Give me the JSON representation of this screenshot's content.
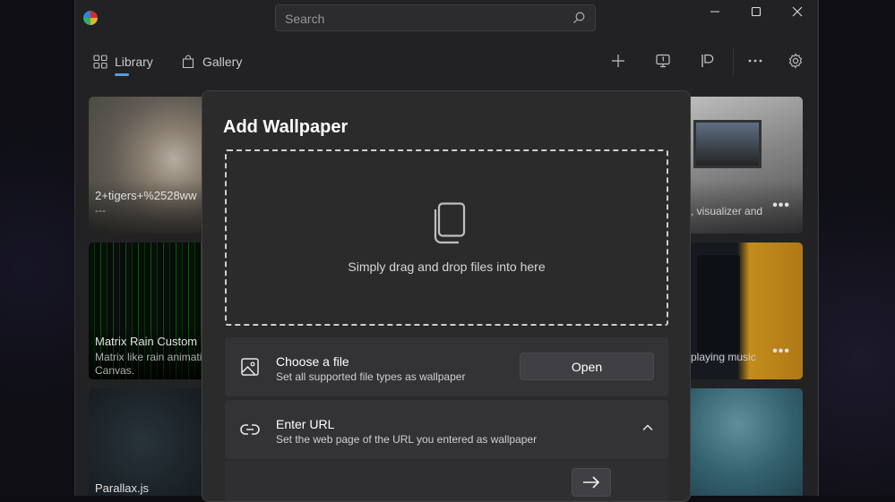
{
  "search": {
    "placeholder": "Search"
  },
  "nav": {
    "tabs": [
      {
        "label": "Library"
      },
      {
        "label": "Gallery"
      }
    ]
  },
  "toolbar": {
    "icons": [
      "add-icon",
      "monitor-icon",
      "flag-icon",
      "more-icon",
      "settings-icon"
    ]
  },
  "cards": [
    {
      "title": "2+tigers+%2528ww",
      "desc": "---"
    },
    {
      "title": "",
      "desc": ", visualizer and"
    },
    {
      "title": "Matrix Rain Custom",
      "desc": "Matrix like rain animati\nCanvas."
    },
    {
      "title": "",
      "desc": "playing music"
    },
    {
      "title": "Parallax.js",
      "desc": ""
    }
  ],
  "dialog": {
    "title": "Add Wallpaper",
    "dropzone_text": "Simply drag and drop files into here",
    "choose_file": {
      "title": "Choose a file",
      "subtitle": "Set all supported file types as wallpaper",
      "button": "Open"
    },
    "enter_url": {
      "title": "Enter URL",
      "subtitle": "Set the web page of the URL you entered as wallpaper"
    }
  },
  "colors": {
    "accent": "#5fb2ff",
    "window_bg": "#27272a",
    "dialog_bg": "#2b2b2b"
  }
}
